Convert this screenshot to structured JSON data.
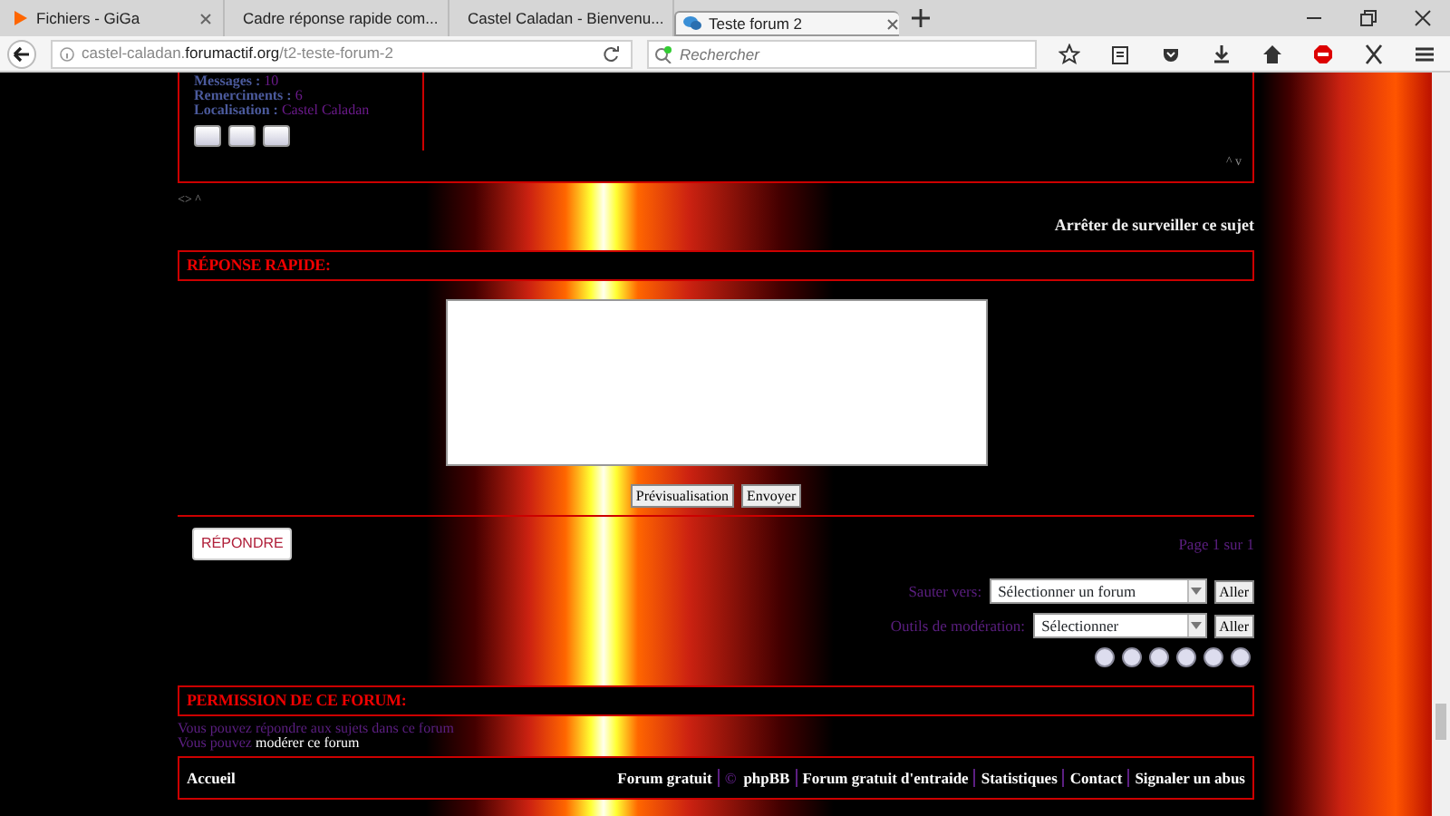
{
  "browser": {
    "tabs": [
      {
        "title": "Fichiers - GiGa",
        "selected": false,
        "kind": "media"
      },
      {
        "title": "Cadre réponse rapide com...",
        "selected": false,
        "kind": "forum"
      },
      {
        "title": "Castel Caladan - Bienvenu...",
        "selected": false,
        "kind": "site"
      },
      {
        "title": "Teste forum 2",
        "selected": true,
        "kind": "forum"
      }
    ],
    "address": [
      {
        "text": "castel-caladan.",
        "kind": "faint"
      },
      {
        "text": "forumactif.org",
        "kind": "domain"
      },
      {
        "text": "/t2-teste-forum-2",
        "kind": "faint"
      }
    ],
    "search": {
      "placeholder": "Rechercher"
    }
  },
  "profile": {
    "fields": [
      {
        "label": "Messages :",
        "value": "10"
      },
      {
        "label": "Remerciments :",
        "value": "6"
      },
      {
        "label": "Localisation :",
        "value": "Castel Caladan"
      }
    ],
    "corner_links": "^ v"
  },
  "post_links": "<> ^",
  "watch_link": "Arrêter de surveiller ce sujet",
  "quick_reply": {
    "title": "RÉPONSE RAPIDE:",
    "buttons": [
      "Prévisualisation",
      "Envoyer"
    ]
  },
  "reply_button": "RÉPONDRE",
  "pagination": "Page 1 sur 1",
  "jumps": [
    {
      "label": "Sauter vers:",
      "value": "Sélectionner un forum",
      "button": "Aller"
    },
    {
      "label": "Outils de modération:",
      "value": "Sélectionner",
      "button": "Aller"
    }
  ],
  "permissions": {
    "title": "PERMISSION DE CE FORUM:",
    "lines": [
      {
        "text": "Vous pouvez répondre aux sujets dans ce forum"
      },
      {
        "text": "Vous pouvez ",
        "link": "modérer ce forum"
      }
    ]
  },
  "footer": {
    "home": "Accueil",
    "links": [
      {
        "text": "Forum gratuit"
      },
      {
        "prefix": "©",
        "text": "phpBB"
      },
      {
        "text": "Forum gratuit d'entraide"
      },
      {
        "text": "Statistiques"
      },
      {
        "text": "Contact"
      },
      {
        "text": "Signaler un abus"
      }
    ]
  }
}
